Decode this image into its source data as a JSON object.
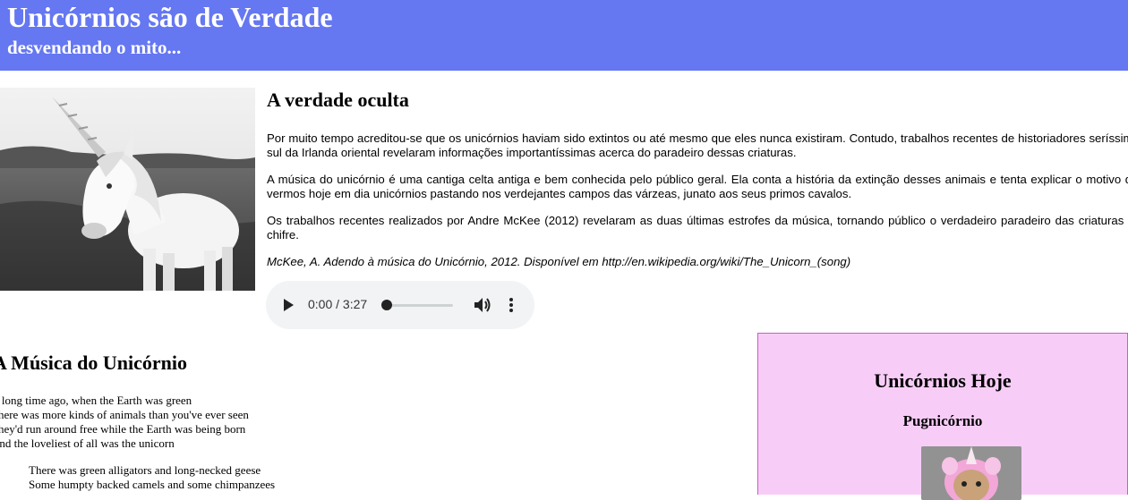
{
  "header": {
    "title": "Unicórnios são de Verdade",
    "subtitle": "desvendando o mito..."
  },
  "article": {
    "heading": "A verdade oculta",
    "paragraphs": [
      "Por muito tempo acreditou-se que os unicórnios haviam sido extintos ou até mesmo que eles nunca existiram. Contudo, trabalhos recentes de historiadores seríssimos do sul da Irlanda oriental revelaram informações importantíssimas acerca do paradeiro dessas criaturas.",
      "A música do unicórnio é uma cantiga celta antiga e bem conhecida pelo público geral. Ela conta a história da extinção desses animais e tenta explicar o motivo de não vermos hoje em dia unicórnios pastando nos verdejantes campos das várzeas, junato aos seus primos cavalos.",
      "Os trabalhos recentes realizados por Andre McKee (2012) revelaram as duas últimas estrofes da música, tornando público o verdadeiro paradeiro das criaturas de um chifre."
    ],
    "citation": "McKee, A. Adendo à música do Unicórnio, 2012. Disponível em http://en.wikipedia.org/wiki/The_Unicorn_(song)"
  },
  "audio": {
    "time": "0:00 / 3:27",
    "progress": 0.0,
    "icons": [
      "play-icon",
      "volume-icon",
      "more-options-icon"
    ]
  },
  "song": {
    "heading": "A Música do Unicórnio",
    "stanza1": [
      "A long time ago, when the Earth was green",
      "There was more kinds of animals than you've ever seen",
      "They'd run around free while the Earth was being born",
      "And the loveliest of all was the unicorn"
    ],
    "stanza2": [
      "There was green alligators and long-necked geese",
      "Some humpty backed camels and some chimpanzees"
    ]
  },
  "aside": {
    "heading": "Unicórnios Hoje",
    "subheading": "Pugnicórnio"
  },
  "colors": {
    "header_bg": "#6577f1",
    "aside_bg": "#f7cdf7",
    "aside_border": "#c760c7"
  }
}
